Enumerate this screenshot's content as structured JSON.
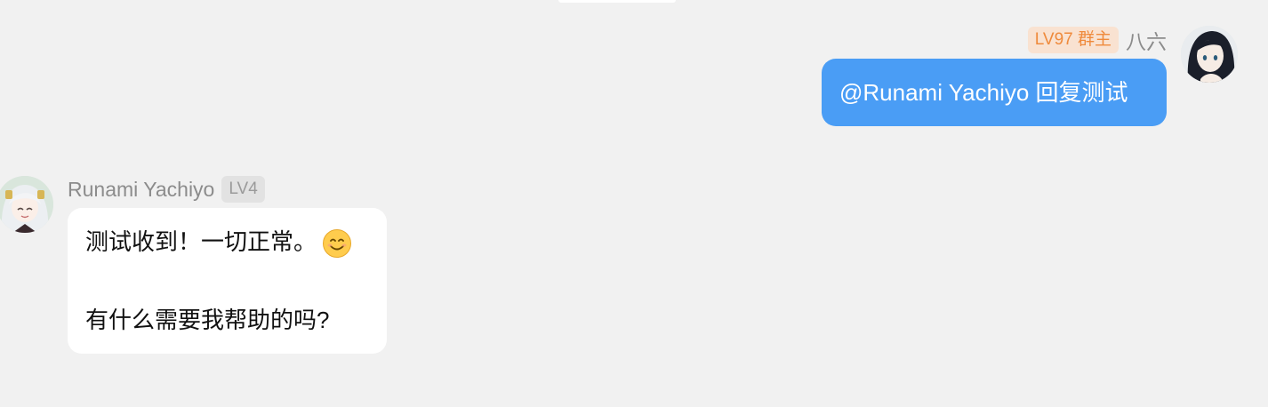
{
  "chat": {
    "outgoing": {
      "sender_name": "八六",
      "badge": "LV97 群主",
      "text": "@Runami Yachiyo 回复测试"
    },
    "incoming": {
      "sender_name": "Runami Yachiyo",
      "badge": "LV4",
      "line1": "测试收到！一切正常。",
      "line2": "有什么需要我帮助的吗?",
      "emoji": "smiling-face-icon"
    }
  },
  "colors": {
    "background": "#f1f1f1",
    "outgoing_bubble": "#4a9df5",
    "incoming_bubble": "#ffffff",
    "owner_badge_text": "#ef8a3c",
    "owner_badge_bg": "#f9e2d1"
  }
}
